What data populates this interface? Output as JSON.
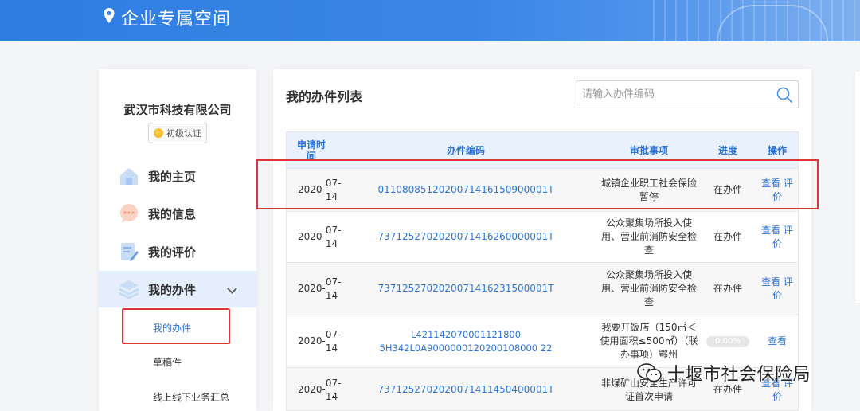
{
  "header": {
    "title": "企业专属空间"
  },
  "sidebar": {
    "company": "武汉市科技有限公司",
    "badge": "初级认证",
    "items": [
      {
        "label": "我的主页",
        "icon": "home-icon"
      },
      {
        "label": "我的信息",
        "icon": "chat-icon"
      },
      {
        "label": "我的评价",
        "icon": "review-icon"
      },
      {
        "label": "我的办件",
        "icon": "layers-icon",
        "expanded": true
      }
    ],
    "subitems": [
      {
        "label": "我的办件",
        "current": true
      },
      {
        "label": "草稿件"
      },
      {
        "label": "线上线下业务汇总"
      }
    ]
  },
  "main": {
    "title": "我的办件列表",
    "search_placeholder": "请输入办件编码",
    "columns": {
      "time": "申请时间",
      "code": "办件编码",
      "item": "审批事项",
      "progress": "进度",
      "action": "操作"
    },
    "rows": [
      {
        "date1": "2020-",
        "date2": "07-14",
        "code": "011080851202007141615090000​1T",
        "item": "城镇企业职工社会保险暂停",
        "status": "在办件",
        "view": "查看",
        "rate": "评价"
      },
      {
        "date1": "2020-",
        "date2": "07-14",
        "code": "7371252702020071416260000001T",
        "item": "公众聚集场所投入使用、营业前消防安全检查",
        "status": "在办件",
        "view": "查看",
        "rate": "评价"
      },
      {
        "date1": "2020-",
        "date2": "07-14",
        "code": "7371252702020071416231500001T",
        "item": "公众聚集场所投入使用、营业前消防安全检查",
        "status": "在办件",
        "view": "查看",
        "rate": "评价"
      },
      {
        "date1": "2020-",
        "date2": "07-14",
        "code": "L421142070001121800 5H342L0A9000000120200108000 22",
        "item": "我要开饭店（150㎡＜使用面积≤500㎡）（联办事项）鄂州",
        "progress_pct": "0.00%",
        "view": "查看"
      },
      {
        "date1": "2020-",
        "date2": "07-14",
        "code": "7371252702020071411450400001T",
        "item": "非煤矿山安全生产许可证首次申请",
        "status": "在办件",
        "view": "查看",
        "rate": "评价"
      }
    ]
  },
  "watermark": "十堰市社会保险局",
  "colors": {
    "accent": "#2d74d7",
    "banner": "#3a86e8",
    "highlight": "#e0343b"
  }
}
